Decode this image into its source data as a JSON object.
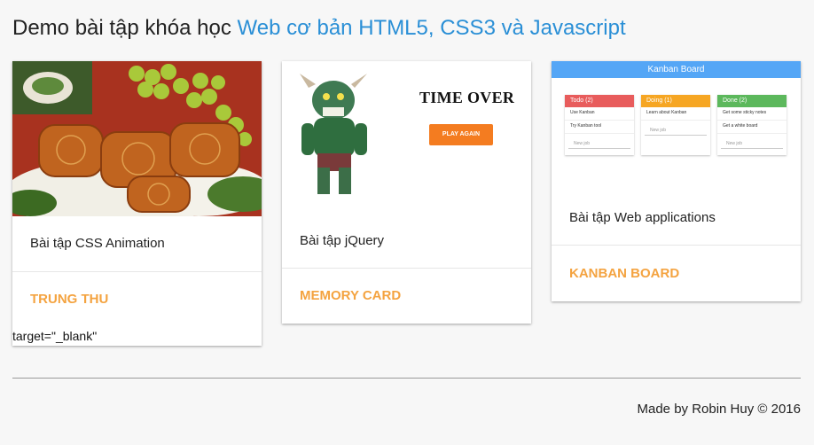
{
  "heading": {
    "prefix": "Demo bài tập khóa học",
    "link": "Web cơ bản HTML5, CSS3 và Javascript"
  },
  "cards": [
    {
      "text": "Bài tập CSS Animation",
      "action": "TRUNG THU",
      "stray_text": "target=\"_blank\""
    },
    {
      "text": "Bài tập jQuery",
      "action": "MEMORY CARD",
      "preview": {
        "title": "TIME OVER",
        "button": "PLAY AGAIN"
      }
    },
    {
      "text": "Bài tập Web applications",
      "action": "KANBAN BOARD",
      "preview": {
        "title": "Kanban Board",
        "columns": [
          {
            "title": "Todo (2)",
            "color": "#e85c5c",
            "items": [
              "Use Kanban",
              "Try Kanban tool"
            ],
            "new": "New job"
          },
          {
            "title": "Doing (1)",
            "color": "#f6a623",
            "items": [
              "Learn about Kanban"
            ],
            "new": "New job"
          },
          {
            "title": "Done (2)",
            "color": "#5cb85c",
            "items": [
              "Get some sticky notes",
              "Get a white board"
            ],
            "new": "New job"
          }
        ]
      }
    }
  ],
  "footer": "Made by Robin Huy © 2016",
  "colors": {
    "accent_link": "#2a8fd6",
    "action_orange": "#f4a340",
    "background": "#f7f7f7"
  }
}
